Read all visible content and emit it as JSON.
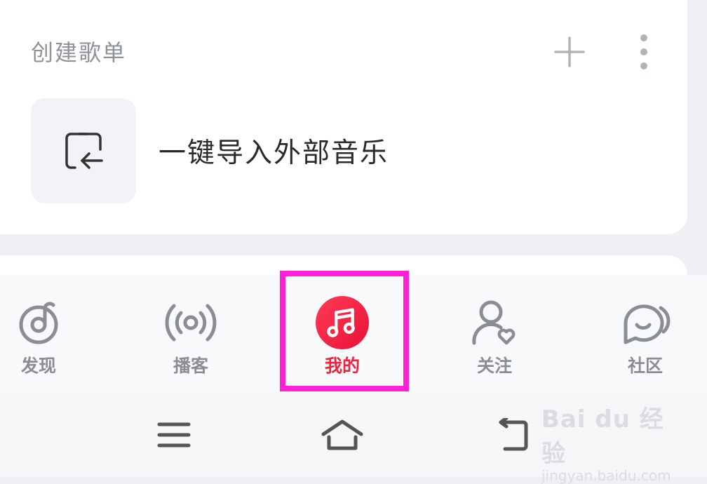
{
  "playlist_section": {
    "title": "创建歌单",
    "import_label": "一键导入外部音乐"
  },
  "tabs": [
    {
      "label": "发现",
      "icon": "netease-note-icon",
      "active": false
    },
    {
      "label": "播客",
      "icon": "broadcast-icon",
      "active": false
    },
    {
      "label": "我的",
      "icon": "music-note-icon",
      "active": true
    },
    {
      "label": "关注",
      "icon": "user-heart-icon",
      "active": false
    },
    {
      "label": "社区",
      "icon": "chat-bubble-icon",
      "active": false
    }
  ],
  "colors": {
    "accent": "#f0233f",
    "highlight_box": "#ff21d8",
    "inactive": "#8a8d94"
  },
  "watermark": {
    "line1": "Bai du 经验",
    "line2": "jingyan.baidu.com"
  }
}
